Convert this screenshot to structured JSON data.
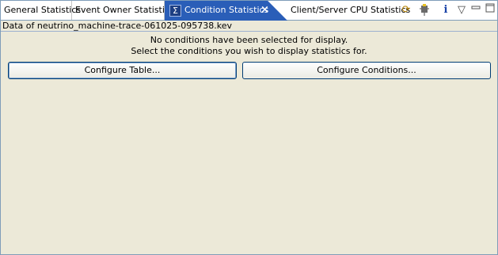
{
  "tabs": [
    {
      "label": "General Statistics"
    },
    {
      "label": "Event Owner Statistics"
    },
    {
      "label": "Condition Statistics",
      "active": true
    },
    {
      "label": "Client/Server CPU Statistics"
    }
  ],
  "active_tab_close": "×",
  "toolbar_icons": {
    "sync": "sync-icon",
    "pin": "pin-icon",
    "info": "info-icon",
    "view_menu": "view-menu-icon",
    "minimize": "minimize-icon",
    "maximize": "maximize-icon"
  },
  "path_label": "Data of neutrino_machine-trace-061025-095738.kev",
  "message": {
    "line1": "No conditions have been selected for display.",
    "line2": "Select the conditions you wish to display statistics for."
  },
  "buttons": {
    "configure_table": "Configure Table...",
    "configure_conditions": "Configure Conditions..."
  },
  "colors": {
    "active_tab": "#2a5eb8",
    "background": "#ece9d8"
  }
}
